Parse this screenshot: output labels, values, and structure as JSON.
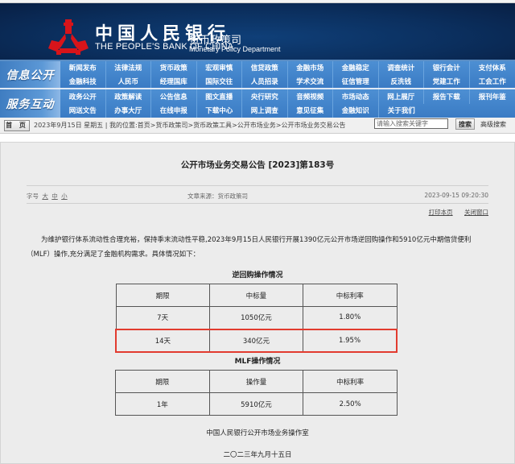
{
  "banner": {
    "cn_name": "中国人民银行",
    "en_name": "THE PEOPLE'S BANK OF CHINA",
    "dept_cn": "货币政策司",
    "dept_en": "Monetary Policy Department",
    "bg_color": "#0b2f5e",
    "logo_color": "#d7141a"
  },
  "nav": {
    "groups": [
      {
        "label": "信息公开",
        "rows": [
          [
            "新闻发布",
            "法律法规",
            "货币政策",
            "宏观审慎",
            "信贷政策",
            "金融市场",
            "金融稳定",
            "调查统计",
            "银行会计",
            "支付体系"
          ],
          [
            "金融科技",
            "人民币",
            "经理国库",
            "国际交往",
            "人员招录",
            "学术交流",
            "征信管理",
            "反洗钱",
            "党建工作",
            "工会工作"
          ]
        ]
      },
      {
        "label": "服务互动",
        "rows": [
          [
            "政务公开",
            "政策解读",
            "公告信息",
            "图文直播",
            "央行研究",
            "音频视频",
            "市场动态",
            "网上展厅",
            "报告下载",
            "报刊年鉴"
          ],
          [
            "网送文告",
            "办事大厅",
            "在线申报",
            "下载中心",
            "网上调查",
            "意见征集",
            "金融知识",
            "关于我们"
          ]
        ]
      }
    ]
  },
  "breadcrumb": {
    "home_label": "首 页",
    "date": "2023年9月15日 星期五",
    "location_prefix": "我的位置:",
    "path": [
      "首页",
      "货币政策司",
      "货币政策工具",
      "公开市场业务",
      "公开市场业务交易公告"
    ],
    "separator": " > "
  },
  "search": {
    "placeholder": "请输入搜索关键字",
    "button_label": "搜索",
    "advanced_label": "高级搜索"
  },
  "article": {
    "title": "公开市场业务交易公告 [2023]第183号",
    "font_size_label": "字号",
    "font_sizes": [
      "大",
      "中",
      "小"
    ],
    "source": "文章来源：货币政策司",
    "timestamp": "2023-09-15 09:20:30",
    "print_label": "打印本页",
    "close_label": "关闭窗口",
    "paragraph": "为维护银行体系流动性合理充裕，保持季末流动性平稳,2023年9月15日人民银行开展1390亿元公开市场逆回购操作和5910亿元中期借贷便利（MLF）操作,充分满足了金融机构需求。具体情况如下：",
    "reverse_repo": {
      "title": "逆回购操作情况",
      "headers": [
        "期限",
        "中标量",
        "中标利率"
      ],
      "rows": [
        [
          "7天",
          "1050亿元",
          "1.80%"
        ],
        [
          "14天",
          "340亿元",
          "1.95%"
        ]
      ],
      "highlight_color": "#e23b2f"
    },
    "mlf": {
      "title": "MLF操作情况",
      "headers": [
        "期限",
        "操作量",
        "中标利率"
      ],
      "rows": [
        [
          "1年",
          "5910亿元",
          "2.50%"
        ]
      ]
    },
    "signature": "中国人民银行公开市场业务操作室",
    "sign_date": "二〇二三年九月十五日"
  }
}
